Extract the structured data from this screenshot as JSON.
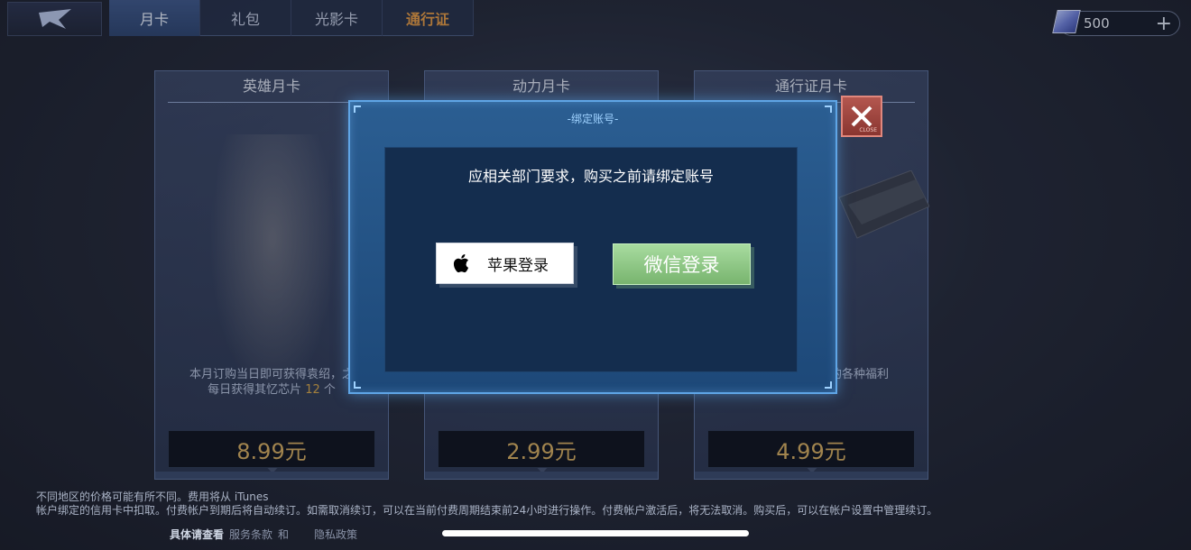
{
  "tabs": [
    {
      "label": "月卡"
    },
    {
      "label": "礼包"
    },
    {
      "label": "光影卡"
    },
    {
      "label": "通行证"
    }
  ],
  "currency": {
    "amount": "500",
    "plus": "+"
  },
  "cards": [
    {
      "title": "英雄月卡",
      "desc_line1": "本月订购当日即可获得袁绍，之",
      "desc_line2": "每日获得其忆芯片",
      "desc_count": "12",
      "desc_unit": "个",
      "price": "8.99元"
    },
    {
      "title": "动力月卡",
      "price": "2.99元"
    },
    {
      "title": "通行证月卡",
      "desc_tail": "的各种福利",
      "price": "4.99元"
    }
  ],
  "dialog": {
    "title": "-绑定账号-",
    "message": "应相关部门要求，购买之前请绑定账号",
    "apple_label": "苹果登录",
    "wechat_label": "微信登录",
    "close_label": "CLOSE"
  },
  "footer": {
    "line1": "不同地区的价格可能有所不同。费用将从 iTunes",
    "line2": "帐户绑定的信用卡中扣取。付费帐户到期后将自动续订。如需取消续订，可以在当前付费周期结束前24小时进行操作。付费帐户激活后，将无法取消。购买后，可以在帐户设置中管理续订。",
    "details": "具体请查看",
    "terms": "服务条款",
    "and": "和",
    "privacy": "隐私政策"
  }
}
